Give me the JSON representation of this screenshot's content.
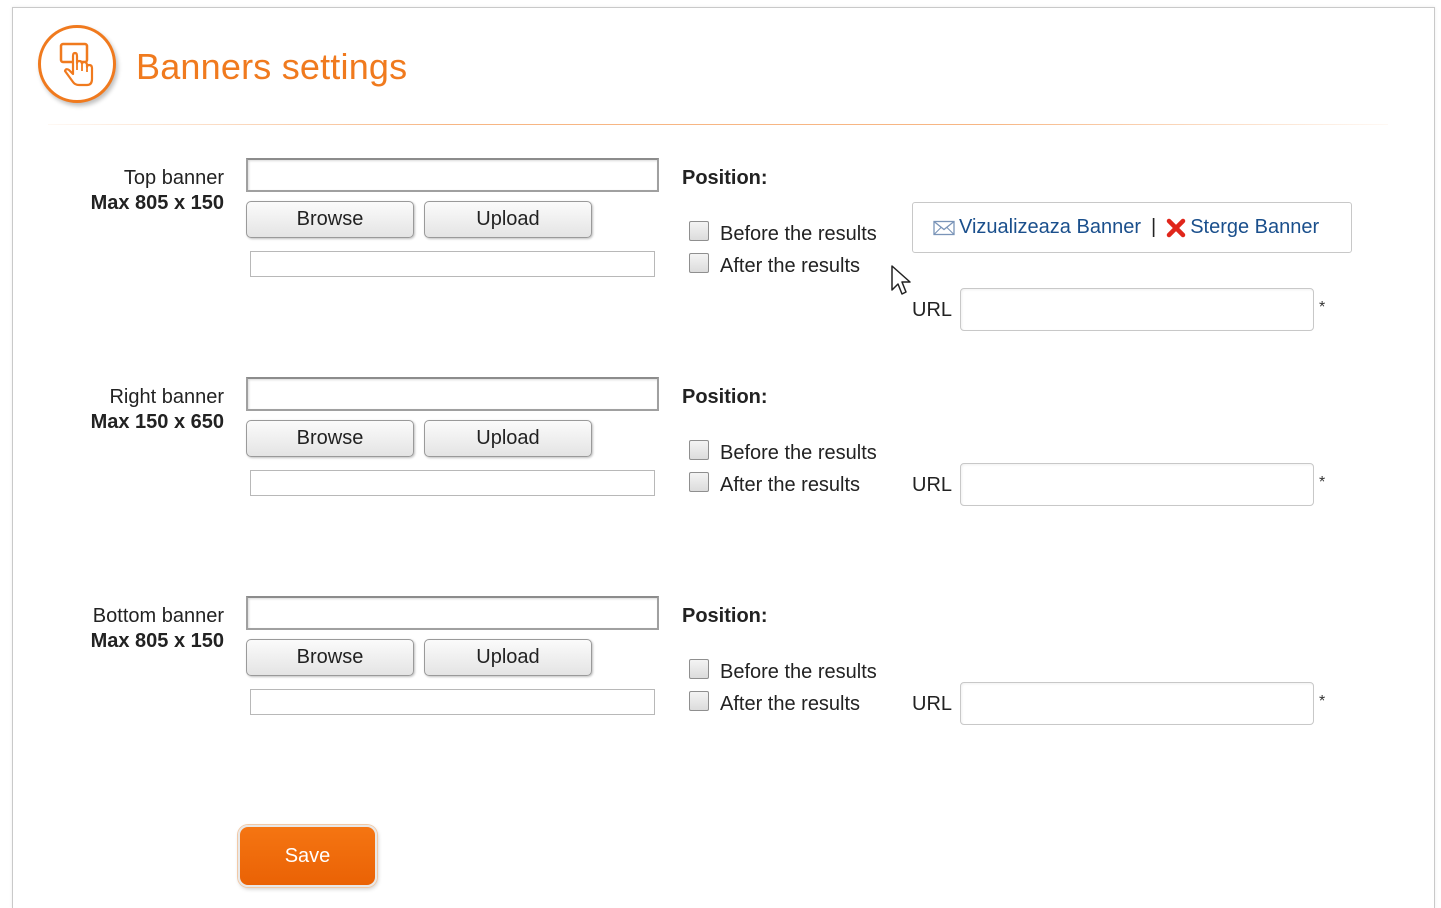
{
  "header": {
    "title": "Banners settings",
    "icon": "hand-pointer-icon",
    "accent_color": "#f07a1e"
  },
  "sections": [
    {
      "name": "Top banner",
      "max_size": "Max 805 x 150",
      "browse_label": "Browse",
      "upload_label": "Upload",
      "position_label": "Position:",
      "before_label": "Before the results",
      "before_checked": false,
      "after_label": "After the results",
      "after_checked": false,
      "url_label": "URL",
      "url_value": "",
      "required_mark": "*"
    },
    {
      "name": "Right banner",
      "max_size": "Max 150 x 650",
      "browse_label": "Browse",
      "upload_label": "Upload",
      "position_label": "Position:",
      "before_label": "Before the results",
      "before_checked": false,
      "after_label": "After the results",
      "after_checked": false,
      "url_label": "URL",
      "url_value": "",
      "required_mark": "*"
    },
    {
      "name": "Bottom banner",
      "max_size": "Max 805 x 150",
      "browse_label": "Browse",
      "upload_label": "Upload",
      "position_label": "Position:",
      "before_label": "Before the results",
      "before_checked": false,
      "after_label": "After the results",
      "after_checked": false,
      "url_label": "URL",
      "url_value": "",
      "required_mark": "*"
    }
  ],
  "banner_actions": {
    "view_label": "Vizualizeaza Banner",
    "view_icon": "envelope-icon",
    "separator": "|",
    "delete_label": "Sterge Banner",
    "delete_icon": "red-x-icon",
    "link_color": "#1a4f8c"
  },
  "save_label": "Save"
}
